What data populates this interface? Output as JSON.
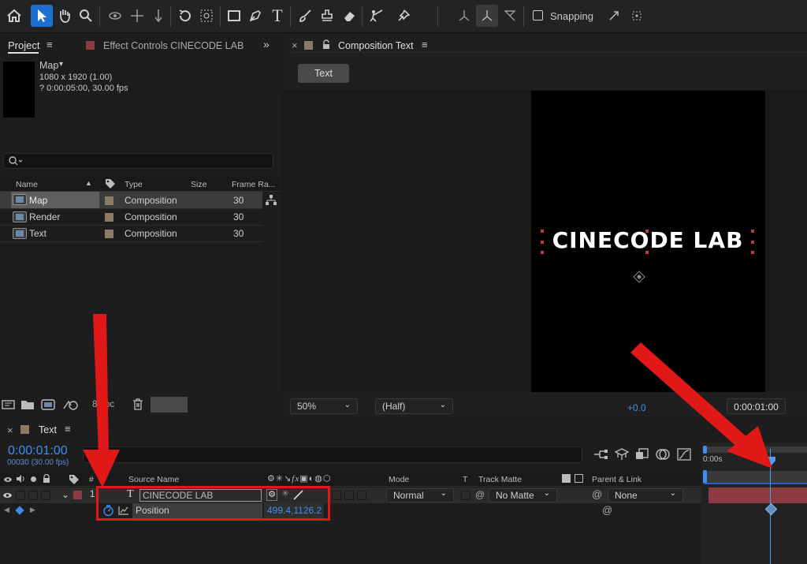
{
  "toolbar": {
    "snapping_label": "Snapping"
  },
  "project": {
    "tab_label": "Project",
    "effect_controls_label": "Effect Controls CINECODE LAB",
    "preview": {
      "name": "Map",
      "dimensions": "1080 x 1920 (1.00)",
      "duration": "? 0:00:05:00, 30.00 fps"
    },
    "search_placeholder": "",
    "columns": {
      "name": "Name",
      "type": "Type",
      "size": "Size",
      "frame_rate": "Frame Ra..."
    },
    "items": [
      {
        "name": "Map",
        "type": "Composition",
        "fps": "30"
      },
      {
        "name": "Render",
        "type": "Composition",
        "fps": "30"
      },
      {
        "name": "Text",
        "type": "Composition",
        "fps": "30"
      }
    ],
    "bpc_label": "8 bpc"
  },
  "composition": {
    "tab_label": "Composition Text",
    "chip_label": "Text",
    "canvas_text": "CINECODE LAB",
    "zoom": "50%",
    "resolution": "(Half)",
    "exposure": "+0.0",
    "timecode": "0:00:01:00"
  },
  "timeline": {
    "tab_label": "Text",
    "timecode": "0:00:01:00",
    "frame_info": "00030 (30.00 fps)",
    "ruler_start": "0:00s",
    "headers": {
      "number": "#",
      "source_name": "Source Name",
      "mode": "Mode",
      "t": "T",
      "track_matte": "Track Matte",
      "parent_link": "Parent & Link"
    },
    "layer": {
      "index": "1",
      "name": "CINECODE LAB",
      "mode": "Normal",
      "track_matte": "No Matte",
      "parent": "None"
    },
    "property": {
      "name": "Position",
      "value": "499.4,1126.2"
    }
  },
  "colors": {
    "accent": "#2d8ceb",
    "highlight": "#e01818",
    "playhead": "#4a9fe8",
    "layer_bar": "#8a3c42"
  }
}
